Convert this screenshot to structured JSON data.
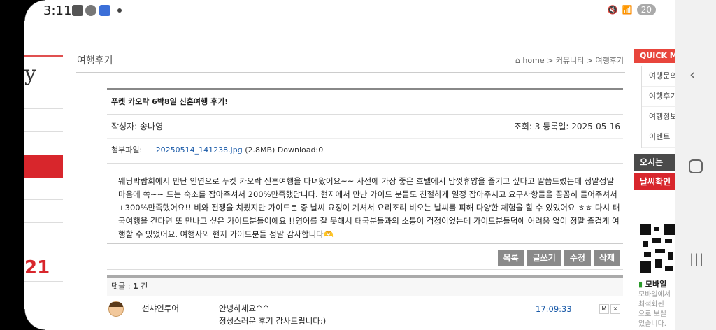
{
  "status": {
    "time": "3:11",
    "battery": "20"
  },
  "left": {
    "partial_title": "y",
    "partial_number": "21"
  },
  "page": {
    "title": "여행후기",
    "breadcrumb": "home > 커뮤니티 > 여행후기"
  },
  "post": {
    "subject": "푸켓 카오락 6박8일 신혼여행 후기!",
    "author_label": "작성자:",
    "author": "송나영",
    "views_label": "조회:",
    "views": "3",
    "date_label": "등록일:",
    "date": "2025-05-16",
    "attach_label": "첨부파일:",
    "attach_name": "20250514_141238.jpg",
    "attach_size": "(2.8MB)",
    "attach_download": "Download:0",
    "body": "웨딩박람회에서 만난 인연으로 푸켓 카오락 신혼여행을 다녀왔어요~~ 사전에 가장 좋은 호텔에서 맘껏휴양을 즐기고 싶다고 말씀드렸는데 정말정말 마음에 쏙~~ 드는 숙소를 잡아주셔서 200%만족했답니다. 현지에서 만난 가이드 분들도 친절하게 일정 잡아주시고 요구사항들을 꼼꼼히 들어주셔서 +300%만족했어요!! 비와 전쟁을 치뤘지만 가이드분 중 날씨 요정이 계셔서 요리조리 비오는 날씨를 피해 다양한 체험을 할 수 있었어요 ㅎㅎ 다시 태국여행을 간다면 또 만나고 싶은 가이드분들이에요 !!영어를 잘 못해서 태국분들과의 소통이 걱정이었는데 가이드분들덕에 어려움 없이 정말 즐겁게 여행할 수 있었어요. 여행사와 현지 가이드분들 정말 감사합니다🫶"
  },
  "buttons": {
    "list": "목록",
    "write": "글쓰기",
    "edit": "수정",
    "delete": "삭제"
  },
  "replies": {
    "label": "댓글 :",
    "count": "1",
    "unit": "건",
    "items": [
      {
        "name": "선샤인투어",
        "text": "안녕하세요^^",
        "time": "17:09:33",
        "m": "M",
        "x": "×"
      }
    ],
    "continued_text": "정성스러운 후기 감사드립니다:)"
  },
  "quick": {
    "header": "QUICK ME",
    "items": [
      "여행문의",
      "여행후기",
      "여행정보",
      "이벤트"
    ],
    "dark_button": "오시는",
    "red_button": "날씨확인",
    "mobile_title": "모바일",
    "mobile_text": [
      "모바일에서",
      "최적화된 ",
      "으로 보실",
      "있습니다."
    ]
  }
}
